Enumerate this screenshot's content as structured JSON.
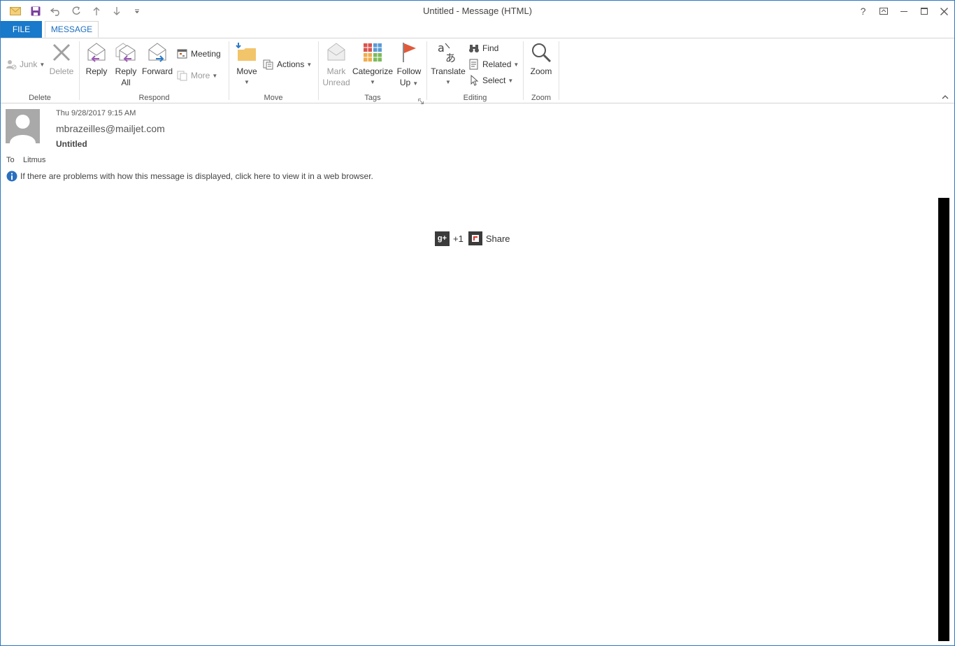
{
  "window": {
    "title": "Untitled - Message (HTML)",
    "help": "?"
  },
  "tabs": {
    "file": "FILE",
    "message": "MESSAGE"
  },
  "ribbon": {
    "delete_group": {
      "label": "Delete",
      "junk": "Junk",
      "delete": "Delete"
    },
    "respond_group": {
      "label": "Respond",
      "reply": "Reply",
      "reply_all_line1": "Reply",
      "reply_all_line2": "All",
      "forward": "Forward",
      "meeting": "Meeting",
      "more": "More"
    },
    "move_group": {
      "label": "Move",
      "move": "Move",
      "actions": "Actions"
    },
    "tags_group": {
      "label": "Tags",
      "mark_unread_line1": "Mark",
      "mark_unread_line2": "Unread",
      "categorize": "Categorize",
      "follow_up_line1": "Follow",
      "follow_up_line2": "Up"
    },
    "editing_group": {
      "label": "Editing",
      "translate": "Translate",
      "find": "Find",
      "related": "Related",
      "select": "Select"
    },
    "zoom_group": {
      "label": "Zoom",
      "zoom": "Zoom"
    }
  },
  "message": {
    "datetime": "Thu 9/28/2017 9:15 AM",
    "sender": "mbrazeilles@mailjet.com",
    "subject": "Untitled",
    "to_label": "To",
    "to_recipient": "Litmus",
    "info_text": "If there are problems with how this message is displayed, click here to view it in a web browser."
  },
  "body": {
    "gplus_icon_text": "g+",
    "plus_one": "+1",
    "share": "Share"
  },
  "colors": {
    "accent": "#1979ca",
    "border": "#2b79c2"
  }
}
